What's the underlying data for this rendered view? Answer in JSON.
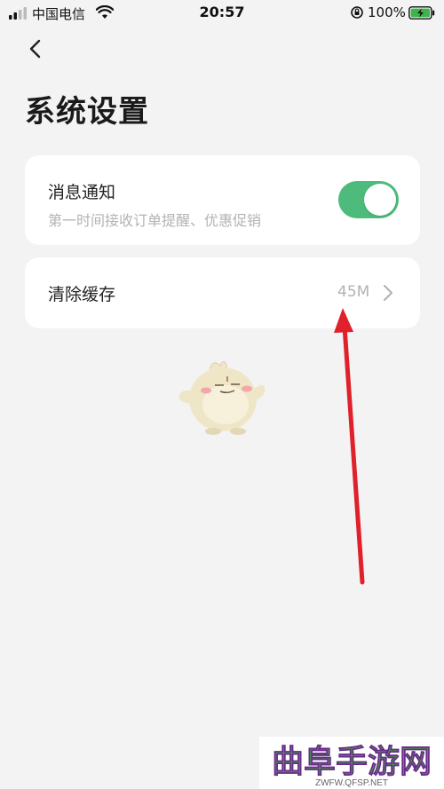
{
  "status_bar": {
    "carrier": "中国电信",
    "time": "20:57",
    "battery": "100%",
    "icons": [
      "signal-icon",
      "wifi-icon",
      "orientation-lock-icon",
      "battery-charging-icon"
    ]
  },
  "nav": {
    "back_icon": "chevron-left-icon"
  },
  "page": {
    "title": "系统设置"
  },
  "settings": {
    "notification": {
      "title": "消息通知",
      "description": "第一时间接收订单提醒、优惠促销",
      "enabled": true
    },
    "cache": {
      "label": "清除缓存",
      "size": "45M",
      "chevron_icon": "chevron-right-icon"
    }
  },
  "watermark": {
    "logo_text": "曲阜手游网",
    "url": "ZWFW.QFSP.NET"
  },
  "colors": {
    "toggle_on": "#4dbb7b",
    "annotation_arrow": "#e0202a",
    "watermark_green": "#3fa33a",
    "watermark_purple": "#6a2a8c"
  }
}
